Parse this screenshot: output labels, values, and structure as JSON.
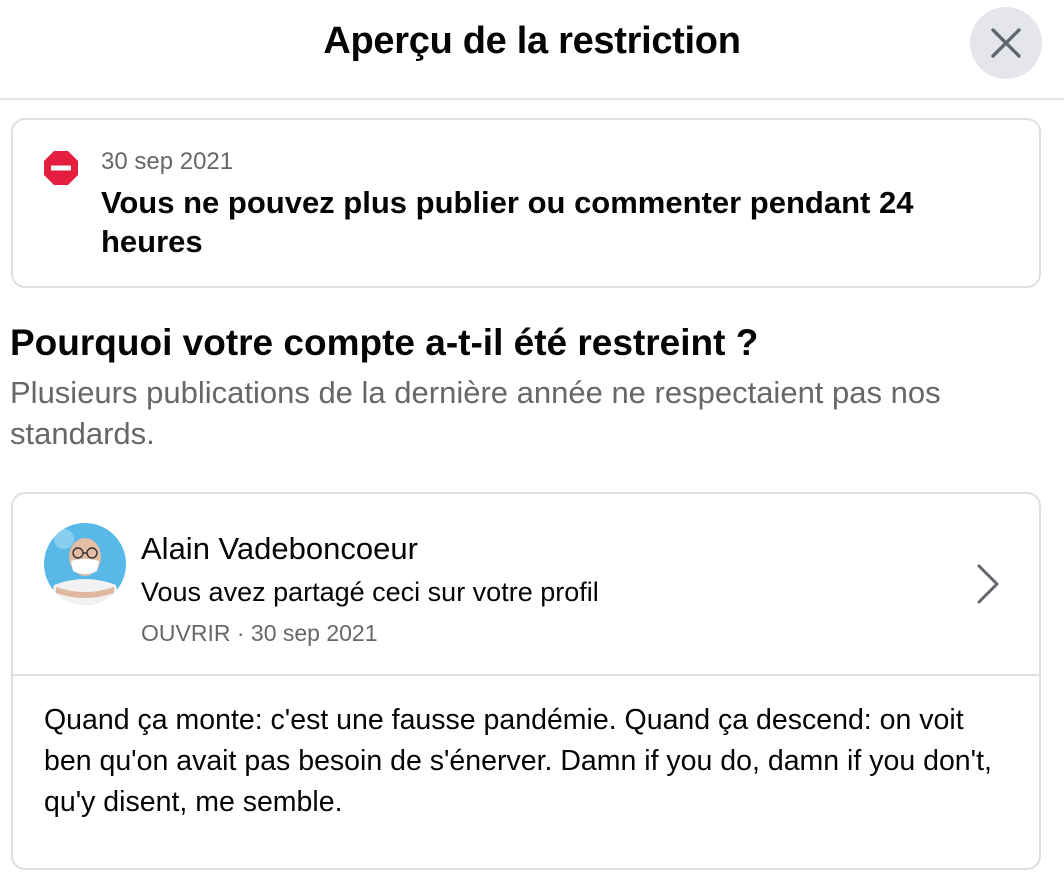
{
  "header": {
    "title": "Aperçu de la restriction",
    "close_icon": "close-icon"
  },
  "restriction": {
    "icon": "stop-icon",
    "icon_color": "#e41e3f",
    "date": "30 sep 2021",
    "message": "Vous ne pouvez plus publier ou commenter pendant 24 heures"
  },
  "reason": {
    "title": "Pourquoi votre compte a-t-il été restreint ?",
    "description": "Plusieurs publications de la dernière année ne respectaient pas nos standards."
  },
  "post": {
    "author": "Alain Vadeboncoeur",
    "share_note": "Vous avez partagé ceci sur votre profil",
    "open_label": "OUVRIR",
    "separator": " · ",
    "date": "30 sep 2021",
    "chevron_icon": "chevron-right-icon",
    "body": "Quand ça monte: c'est une fausse pandémie. Quand ça descend: on voit ben qu'on avait pas besoin de s'énerver. Damn if you do, damn if you don't, qu'y disent, me semble."
  }
}
